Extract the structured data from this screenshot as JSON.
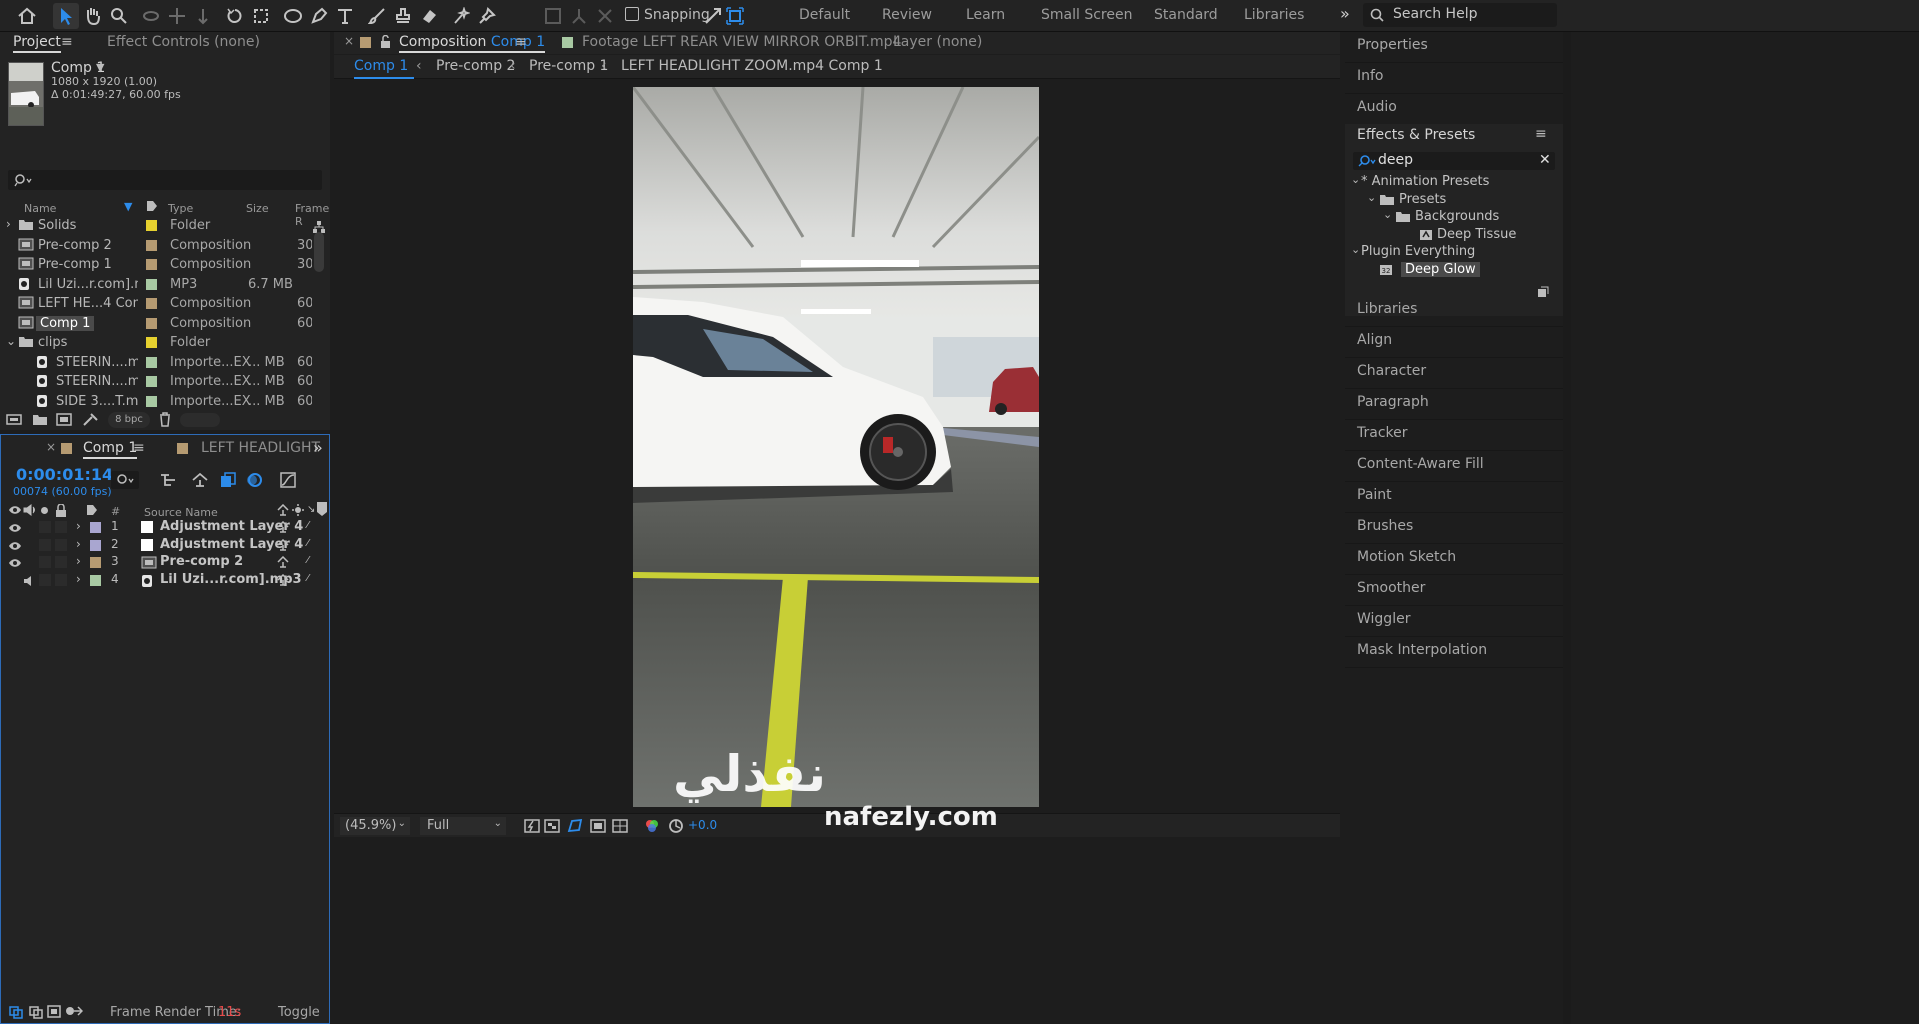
{
  "toolbar": {
    "snapping_label": "Snapping",
    "workspaces": [
      "Default",
      "Review",
      "Learn",
      "Small Screen",
      "Standard",
      "Libraries"
    ],
    "search_placeholder": "Search Help",
    "tools": [
      "home-icon",
      "selection-icon",
      "hand-icon",
      "zoom-icon",
      "orbit-icon",
      "pan-icon",
      "dolly-icon",
      "rotate-icon",
      "region-icon",
      "ellipse-icon",
      "pen-icon",
      "type-icon",
      "brush-icon",
      "clone-stamp-icon",
      "eraser-icon",
      "roto-brush-icon",
      "puppet-pin-icon"
    ]
  },
  "project": {
    "tab_project": "Project",
    "tab_effect_controls": "Effect Controls (none)",
    "comp_name": "Comp 1",
    "comp_size": "1080 x 1920 (1.00)",
    "comp_duration": "Δ 0:01:49:27, 60.00 fps",
    "columns": {
      "name": "Name",
      "type": "Type",
      "size": "Size",
      "frame_rate": "Frame R"
    },
    "items": [
      {
        "name": "Solids",
        "type": "Folder",
        "size": "",
        "fps": "",
        "icon": "folder",
        "color": "#e6d12f",
        "expander": "›",
        "indent": 0
      },
      {
        "name": "Pre-comp 2",
        "type": "Composition",
        "size": "",
        "fps": "30",
        "icon": "comp",
        "color": "#b69b72",
        "expander": "",
        "indent": 0
      },
      {
        "name": "Pre-comp 1",
        "type": "Composition",
        "size": "",
        "fps": "30",
        "icon": "comp",
        "color": "#b69b72",
        "expander": "",
        "indent": 0
      },
      {
        "name": "Lil Uzi...r.com].mp3",
        "type": "MP3",
        "size": "6.7 MB",
        "fps": "",
        "icon": "file",
        "color": "#a8c9a3",
        "expander": "",
        "indent": 0
      },
      {
        "name": "LEFT HE...4 Comp 1",
        "type": "Composition",
        "size": "",
        "fps": "60",
        "icon": "comp",
        "color": "#b69b72",
        "expander": "",
        "indent": 0
      },
      {
        "name": "Comp 1",
        "type": "Composition",
        "size": "",
        "fps": "60",
        "icon": "comp",
        "color": "#b69b72",
        "expander": "",
        "indent": 0,
        "selected": true
      },
      {
        "name": "clips",
        "type": "Folder",
        "size": "",
        "fps": "",
        "icon": "folder",
        "color": "#e6d12f",
        "expander": "⌄",
        "indent": 0
      },
      {
        "name": "STEERIN....mp4",
        "type": "Importe...EX",
        "size": "... MB",
        "fps": "60",
        "icon": "file",
        "color": "#a8c9a3",
        "expander": "",
        "indent": 1
      },
      {
        "name": "STEERIN....mp4",
        "type": "Importe...EX",
        "size": "... MB",
        "fps": "60",
        "icon": "file",
        "color": "#a8c9a3",
        "expander": "",
        "indent": 1
      },
      {
        "name": "SIDE 3....T.mp4",
        "type": "Importe...EX",
        "size": "... MB",
        "fps": "60",
        "icon": "file",
        "color": "#a8c9a3",
        "expander": "",
        "indent": 1
      }
    ],
    "bpc": "8 bpc"
  },
  "timeline": {
    "tab_comp": "Comp 1",
    "tab_other": "LEFT HEADLIGHT",
    "timecode": "0:00:01:14",
    "frame_info": "00074 (60.00 fps)",
    "col_num": "#",
    "col_source": "Source Name",
    "layers": [
      {
        "num": "1",
        "name": "Adjustment Layer 4",
        "color": "#a9a6d0",
        "type": "solid",
        "eye": true,
        "audio": false
      },
      {
        "num": "2",
        "name": "Adjustment Layer 4",
        "color": "#a9a6d0",
        "type": "solid",
        "eye": true,
        "audio": false
      },
      {
        "num": "3",
        "name": "Pre-comp 2",
        "color": "#b69b72",
        "type": "comp",
        "eye": true,
        "audio": false
      },
      {
        "num": "4",
        "name": "Lil Uzi...r.com].mp3",
        "color": "#a8c9a3",
        "type": "file",
        "eye": false,
        "audio": true
      }
    ],
    "frame_render_label": "Frame Render Time:",
    "frame_render_value": "11s",
    "toggle_label": "Toggle"
  },
  "viewer": {
    "tab_composition_prefix": "Composition",
    "tab_composition_name": "Comp 1",
    "tab_footage": "Footage  LEFT REAR VIEW MIRROR ORBIT.mp4",
    "tab_layer": "Layer  (none)",
    "breadcrumbs": [
      "Comp 1",
      "Pre-comp 2",
      "Pre-comp 1",
      "LEFT HEADLIGHT ZOOM.mp4 Comp 1"
    ],
    "zoom": "(45.9%)",
    "resolution": "Full",
    "exposure": "+0.0",
    "watermark_text": "nafezly.com"
  },
  "right_panel": {
    "top_items": [
      "Properties",
      "Info",
      "Audio"
    ],
    "effects_title": "Effects & Presets",
    "search_value": "deep",
    "tree": [
      {
        "label": "* Animation Presets",
        "level": 0,
        "kind": "expander"
      },
      {
        "label": "Presets",
        "level": 1,
        "kind": "folder"
      },
      {
        "label": "Backgrounds",
        "level": 2,
        "kind": "folder"
      },
      {
        "label": "Deep Tissue",
        "level": 3,
        "kind": "preset"
      },
      {
        "label": "Plugin Everything",
        "level": 0,
        "kind": "expander"
      },
      {
        "label": "Deep Glow",
        "level": 1,
        "kind": "effect",
        "selected": true
      }
    ],
    "bottom_items": [
      "Libraries",
      "Align",
      "Character",
      "Paragraph",
      "Tracker",
      "Content-Aware Fill",
      "Paint",
      "Brushes",
      "Motion Sketch",
      "Smoother",
      "Wiggler",
      "Mask Interpolation"
    ]
  },
  "colors": {
    "accent": "#2d8ceb",
    "timecode": "#2d8ceb",
    "render_time": "#e84a4a",
    "label_comp": "#b69b72",
    "label_folder": "#e6d12f"
  }
}
